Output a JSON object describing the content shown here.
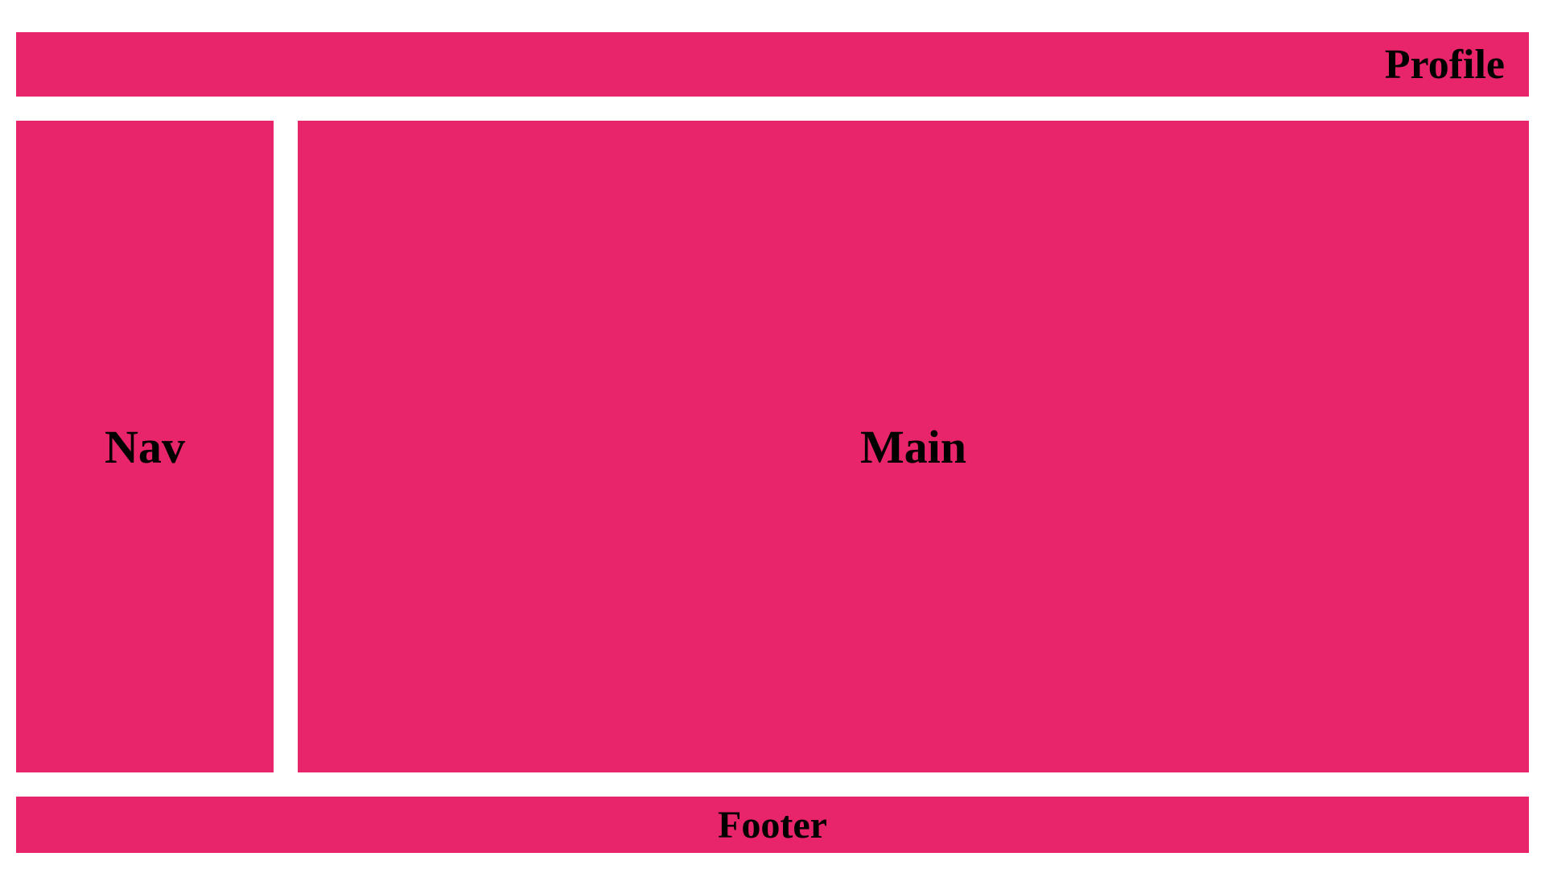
{
  "header": {
    "label": "Profile"
  },
  "nav": {
    "label": "Nav"
  },
  "main": {
    "label": "Main"
  },
  "footer": {
    "label": "Footer"
  },
  "colors": {
    "panel_bg": "#e8256b"
  }
}
